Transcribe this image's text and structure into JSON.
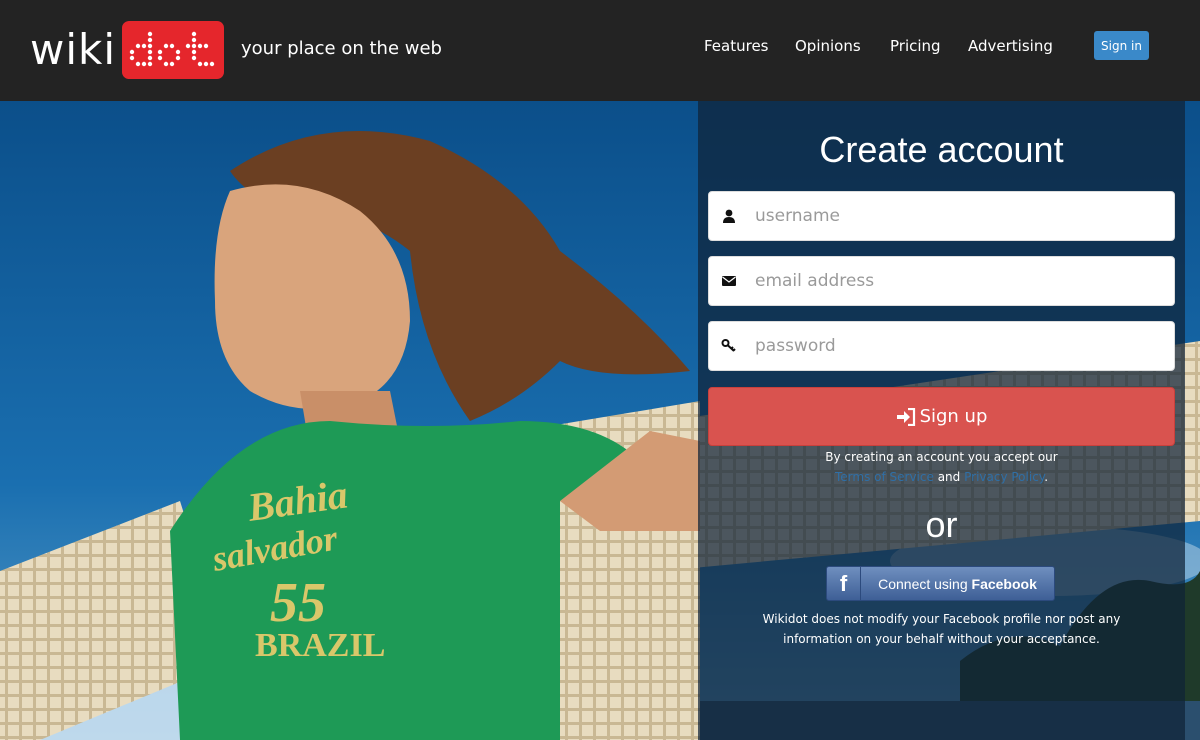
{
  "header": {
    "logo_left": "wiki",
    "logo_right": "dot",
    "tagline": "your place on the web",
    "nav": [
      "Features",
      "Opinions",
      "Pricing",
      "Advertising"
    ],
    "signin_label": "Sign in"
  },
  "form": {
    "title": "Create account",
    "username_placeholder": "username",
    "email_placeholder": "email address",
    "password_placeholder": "password",
    "signup_label": "Sign up",
    "terms_prefix": "By creating an account you accept our",
    "terms_link": "Terms of Service",
    "terms_and": "and",
    "privacy_link": "Privacy Policy",
    "terms_suffix": ".",
    "or_label": "or",
    "fb_prefix": "Connect using",
    "fb_brand": "Facebook",
    "fb_note": "Wikidot does not modify your Facebook profile nor post any information on your behalf without your acceptance."
  },
  "hero": {
    "shirt_text": [
      "Bahia",
      "salvador",
      "55",
      "BRAZIL"
    ]
  },
  "colors": {
    "header_bg": "#232323",
    "logo_red": "#e5262c",
    "signin_blue": "#3a89c9",
    "signup_red": "#d9534f",
    "facebook_blue": "#3e5f96"
  }
}
